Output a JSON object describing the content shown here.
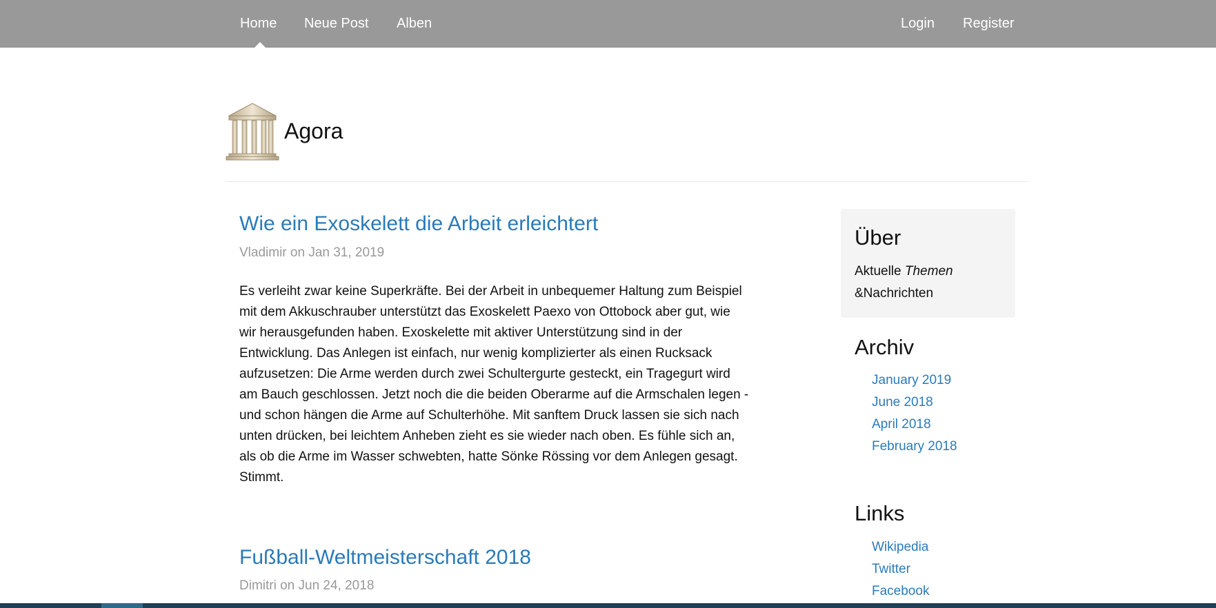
{
  "navbar": {
    "left_items": [
      {
        "label": "Home"
      },
      {
        "label": "Neue Post"
      },
      {
        "label": "Alben"
      }
    ],
    "right_items": [
      {
        "label": "Login"
      },
      {
        "label": "Register"
      }
    ],
    "active_item": "Home"
  },
  "brand": {
    "title": "Agora",
    "logo_icon": "greek-temple-icon"
  },
  "posts": [
    {
      "title": "Wie ein Exoskelett die Arbeit erleichtert",
      "meta": "Vladimir on Jan 31, 2019",
      "body": "Es verleiht zwar keine Superkräfte. Bei der Arbeit in unbequemer Haltung zum Beispiel mit dem Akkuschrauber unterstützt das Exoskelett Paexo von Ottobock aber gut, wie wir herausgefunden haben. Exoskelette mit aktiver Unterstützung sind in der Entwicklung. Das Anlegen ist einfach, nur wenig komplizierter als einen Rucksack aufzusetzen: Die Arme werden durch zwei Schultergurte gesteckt, ein Tragegurt wird am Bauch geschlossen. Jetzt noch die die beiden Oberarme auf die Armschalen legen - und schon hängen die Arme auf Schulterhöhe. Mit sanftem Druck lassen sie sich nach unten drücken, bei leichtem Anheben zieht es sie wieder nach oben. Es fühle sich an, als ob die Arme im Wasser schwebten, hatte Sönke Rössing vor dem Anlegen gesagt. Stimmt."
    },
    {
      "title": "Fußball-Weltmeisterschaft 2018",
      "meta": "Dimitri on Jun 24, 2018"
    }
  ],
  "sidebar": {
    "about": {
      "heading": "Über",
      "text_plain": "Aktuelle ",
      "text_italic": "Themen",
      "text_rest": "&Nachrichten"
    },
    "archive": {
      "heading": "Archiv",
      "items": [
        "January 2019",
        "June 2018",
        "April 2018",
        "February 2018"
      ]
    },
    "links": {
      "heading": "Links",
      "items": [
        "Wikipedia",
        "Twitter",
        "Facebook"
      ]
    }
  },
  "colors": {
    "navbar_bg": "#999999",
    "link": "#2a7ab8",
    "meta": "#999999",
    "about_bg": "#f4f4f4"
  }
}
